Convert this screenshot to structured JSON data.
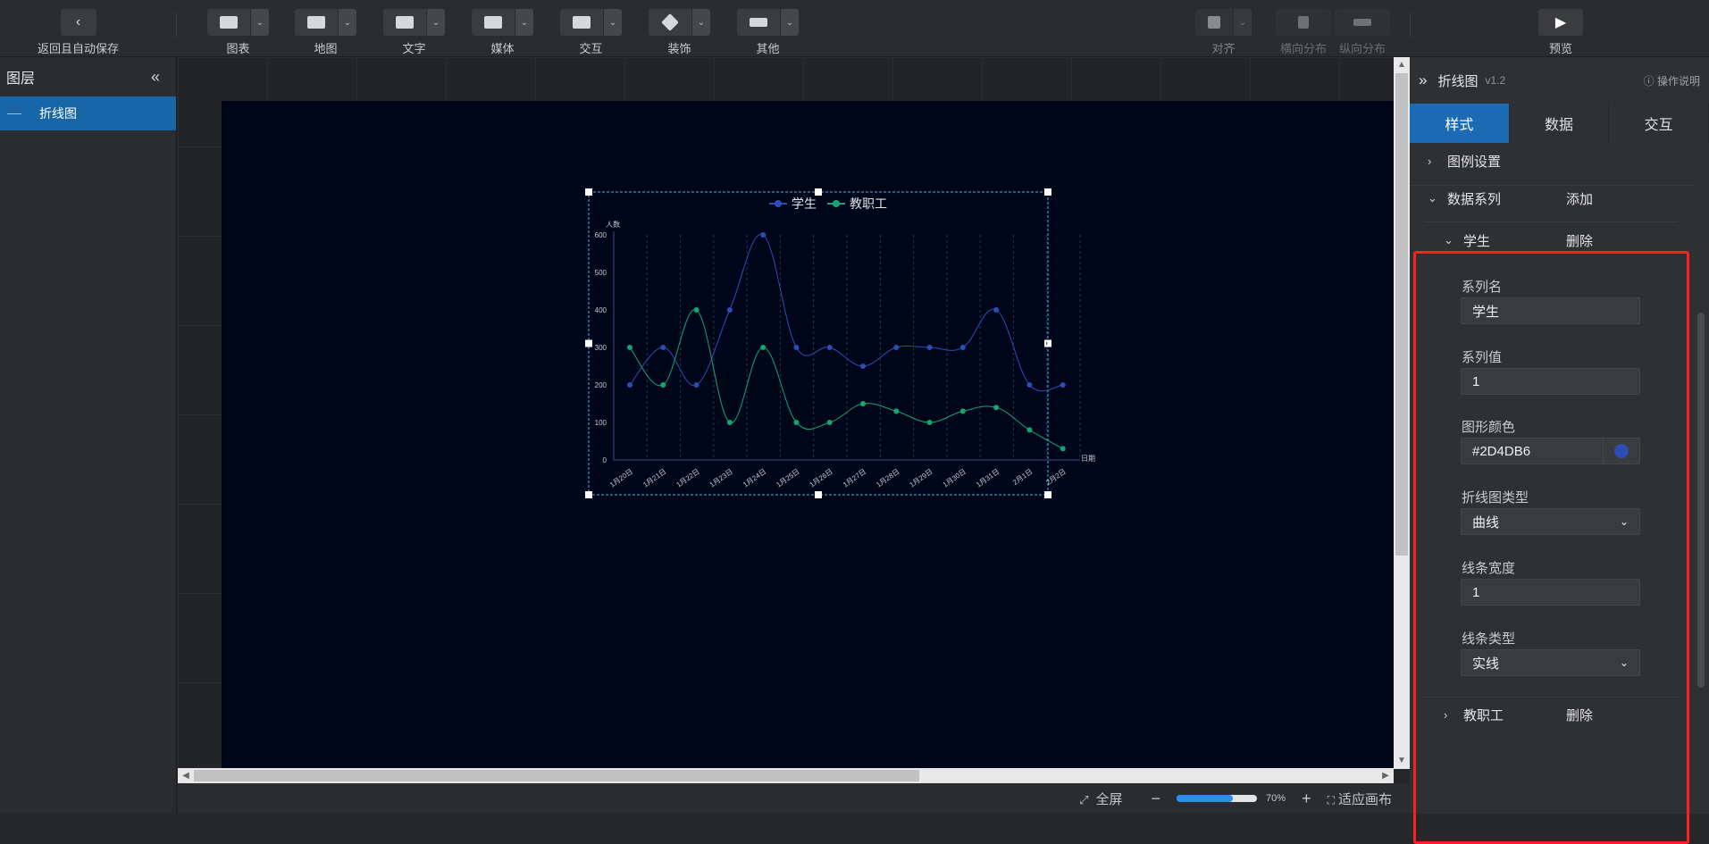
{
  "toolbar": {
    "back_label": "返回且自动保存",
    "groups": [
      {
        "label": "图表",
        "icon": "bar-chart-icon"
      },
      {
        "label": "地图",
        "icon": "map-icon"
      },
      {
        "label": "文字",
        "icon": "text-icon"
      },
      {
        "label": "媒体",
        "icon": "media-icon"
      },
      {
        "label": "交互",
        "icon": "interaction-icon"
      },
      {
        "label": "装饰",
        "icon": "decoration-icon"
      },
      {
        "label": "其他",
        "icon": "other-icon"
      }
    ],
    "align_label": "对齐",
    "hdist_label": "横向分布",
    "vdist_label": "纵向分布",
    "preview_label": "预览"
  },
  "layers": {
    "title": "图层",
    "items": [
      {
        "label": "折线图"
      }
    ]
  },
  "statusbar": {
    "fullscreen": "全屏",
    "zoom": "70%",
    "fit": "适应画布",
    "zoom_fraction": 0.7
  },
  "panel": {
    "title": "折线图",
    "version": "v1.2",
    "help": "操作说明",
    "tabs": [
      "样式",
      "数据",
      "交互"
    ],
    "legend_settings": "图例设置",
    "data_series": "数据系列",
    "add": "添加",
    "series_open": {
      "name": "学生",
      "delete": "删除",
      "name_label": "系列名",
      "name_value": "学生",
      "value_label": "系列值",
      "value_value": "1",
      "color_label": "图形颜色",
      "color_value": "#2D4DB6",
      "type_label": "折线图类型",
      "type_value": "曲线",
      "width_label": "线条宽度",
      "width_value": "1",
      "style_label": "线条类型",
      "style_value": "实线"
    },
    "series_closed": {
      "name": "教职工",
      "delete": "删除"
    }
  },
  "chart_data": {
    "type": "line",
    "categories": [
      "1月20日",
      "1月21日",
      "1月22日",
      "1月23日",
      "1月24日",
      "1月25日",
      "1月26日",
      "1月27日",
      "1月28日",
      "1月29日",
      "1月30日",
      "1月31日",
      "2月1日",
      "2月2日"
    ],
    "series": [
      {
        "name": "学生",
        "color": "#2D4DB6",
        "values": [
          200,
          300,
          200,
          400,
          600,
          300,
          300,
          250,
          300,
          300,
          300,
          400,
          200,
          200
        ]
      },
      {
        "name": "教职工",
        "color": "#13A574",
        "values": [
          300,
          200,
          400,
          100,
          300,
          100,
          100,
          150,
          130,
          100,
          130,
          140,
          80,
          30
        ]
      }
    ],
    "xlabel": "日期",
    "ylabel": "人数",
    "ylim": [
      0,
      600
    ],
    "yticks": [
      0,
      100,
      200,
      300,
      400,
      500,
      600
    ],
    "legend": "top-center",
    "smooth": true
  }
}
